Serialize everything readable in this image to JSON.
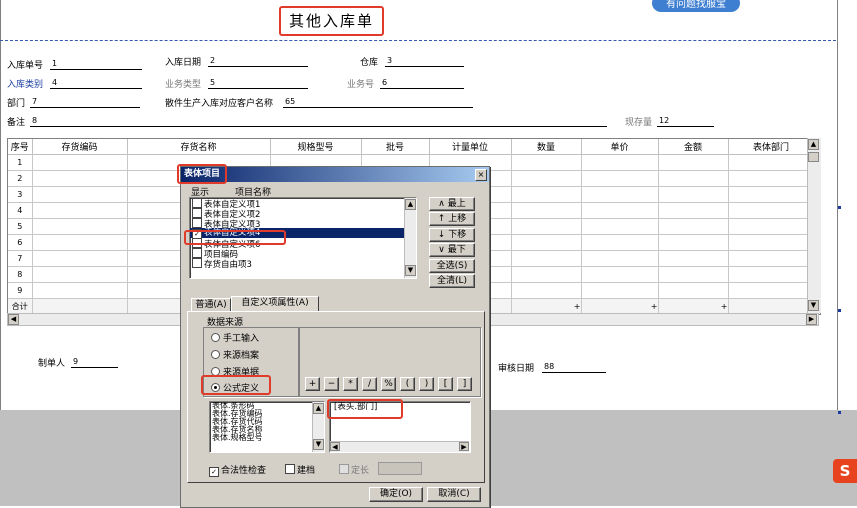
{
  "header": {
    "title": "其他入库单",
    "help_badge": "有问题找服宝"
  },
  "form": {
    "doc_no": {
      "label": "入库单号",
      "value": "1"
    },
    "in_date": {
      "label": "入库日期",
      "value": "2"
    },
    "warehouse": {
      "label": "仓库",
      "value": "3"
    },
    "in_type": {
      "label": "入库类别",
      "value": "4"
    },
    "biz_type": {
      "label": "业务类型",
      "value": "5"
    },
    "biz_no": {
      "label": "业务号",
      "value": "6"
    },
    "department": {
      "label": "部门",
      "value": "7"
    },
    "customer": {
      "label": "散件生产入库对应客户名称",
      "value": "65"
    },
    "remark": {
      "label": "备注",
      "value": "8"
    },
    "stock": {
      "label": "现存量",
      "value": "12"
    }
  },
  "grid": {
    "columns": [
      "序号",
      "存货编码",
      "存货名称",
      "规格型号",
      "批号",
      "计量单位",
      "数量",
      "单价",
      "金额",
      "表体部门"
    ],
    "rows": [
      "1",
      "2",
      "3",
      "4",
      "5",
      "6",
      "7",
      "8",
      "9"
    ],
    "total_label": "合计",
    "total_marks": [
      "+",
      "+",
      "+"
    ]
  },
  "footer": {
    "maker": {
      "label": "制单人",
      "value": "9"
    },
    "audit_date": {
      "label": "审核日期",
      "value": "88"
    }
  },
  "dialog": {
    "title": "表体项目",
    "close": "×",
    "col_show": "显示",
    "col_name": "项目名称",
    "items": [
      {
        "label": "表体自定义项1",
        "checked": false,
        "selected": false
      },
      {
        "label": "表体自定义项2",
        "checked": false,
        "selected": false
      },
      {
        "label": "表体自定义项3",
        "checked": false,
        "selected": false
      },
      {
        "label": "表体自定义项4",
        "checked": true,
        "selected": true
      },
      {
        "label": "表体自定义项6",
        "checked": false,
        "selected": false
      },
      {
        "label": "项目编码",
        "checked": false,
        "selected": false
      },
      {
        "label": "存货自由项3",
        "checked": false,
        "selected": false
      }
    ],
    "btn_top": "∧ 最上",
    "btn_up": "↑ 上移",
    "btn_down": "↓ 下移",
    "btn_bottom": "∨ 最下",
    "btn_select_all": "全选(S)",
    "btn_clear_all": "全清(L)",
    "tab_general": "普通(A)",
    "tab_custom": "自定义项属性(A)",
    "source_group": "数据来源",
    "source_options": [
      {
        "label": "手工输入",
        "on": false
      },
      {
        "label": "来源档案",
        "on": false
      },
      {
        "label": "来源单据",
        "on": false
      },
      {
        "label": "公式定义",
        "on": true
      }
    ],
    "operators": [
      "+",
      "−",
      "*",
      "/",
      "%",
      "(",
      ")",
      "[",
      "]"
    ],
    "fields": [
      "表体.条形码",
      "表体.存货编码",
      "表体.存货代码",
      "表体.存货名称",
      "表体.规格型号"
    ],
    "formula": "[表头.部门]",
    "check_validity": "合法性检查",
    "check_build": "建档",
    "check_fixed_len": "定长",
    "ok": "确定(O)",
    "cancel": "取消(C)"
  },
  "taskbar": {
    "sogou": "S"
  }
}
